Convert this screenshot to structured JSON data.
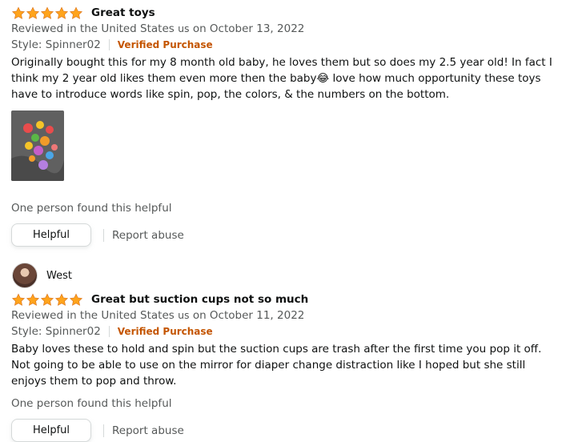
{
  "colors": {
    "star": "#ffa41c",
    "verified": "#c45500",
    "meta": "#565959"
  },
  "icons": {
    "rating": "star-icon"
  },
  "reviews": [
    {
      "rating": 5,
      "title": "Great toys",
      "meta_prefix": "Reviewed in the United States",
      "country_code": "us",
      "meta_suffix": "on October 13, 2022",
      "style": "Style: Spinner02",
      "verified": "Verified Purchase",
      "body": "Originally bought this for my 8 month old baby, he loves them but so does my 2.5 year old! In fact I think my 2 year old likes them even more then the baby😂 love how much opportunity these toys have to introduce words like spin, pop, the colors, & the numbers on the bottom.",
      "helpful_count": "One person found this helpful",
      "helpful_button": "Helpful",
      "report": "Report abuse"
    },
    {
      "reviewer": "West",
      "rating": 5,
      "title": "Great but suction cups not so much",
      "meta_prefix": "Reviewed in the United States",
      "country_code": "us",
      "meta_suffix": "on October 11, 2022",
      "style": "Style: Spinner02",
      "verified": "Verified Purchase",
      "body": "Baby loves these to hold and spin but the suction cups are trash after the first time you pop it off. Not going to be able to use on the mirror for diaper change distraction like I hoped but she still enjoys them to pop and throw.",
      "helpful_count": "One person found this helpful",
      "helpful_button": "Helpful",
      "report": "Report abuse"
    }
  ]
}
